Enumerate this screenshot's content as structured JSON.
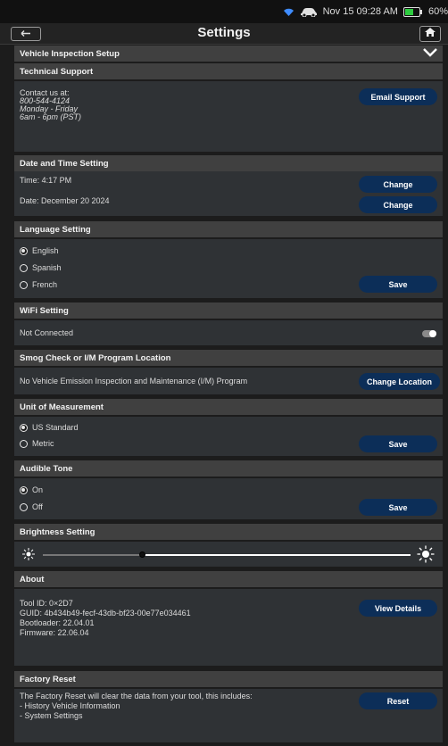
{
  "status": {
    "date_time": "Nov 15  09:28 AM",
    "battery": "60%",
    "battery_level": 0.6
  },
  "header": {
    "title": "Settings"
  },
  "vehicle_inspection": {
    "title": "Vehicle Inspection Setup"
  },
  "technical_support": {
    "title": "Technical Support",
    "contact_label": "Contact us at:",
    "phone": "800-544-4124",
    "days": "Monday - Friday",
    "hours": "6am - 6pm (PST)",
    "email_button": "Email Support"
  },
  "date_time": {
    "title": "Date and Time Setting",
    "time": "Time: 4:17 PM",
    "date": "Date: December 20 2024",
    "change_button": "Change"
  },
  "language": {
    "title": "Language Setting",
    "options": [
      "English",
      "Spanish",
      "French"
    ],
    "selected": "English",
    "save_button": "Save"
  },
  "wifi": {
    "title": "WiFi Setting",
    "status": "Not Connected"
  },
  "smog": {
    "title": "Smog Check or I/M Program Location",
    "program": "No Vehicle Emission Inspection and Maintenance (I/M) Program",
    "change_button": "Change Location"
  },
  "units": {
    "title": "Unit of Measurement",
    "options": [
      "US Standard",
      "Metric"
    ],
    "selected": "US Standard",
    "save_button": "Save"
  },
  "tone": {
    "title": "Audible Tone",
    "options": [
      "On",
      "Off"
    ],
    "selected": "On",
    "save_button": "Save"
  },
  "brightness": {
    "title": "Brightness Setting",
    "level": 0.27
  },
  "about": {
    "title": "About",
    "tool_id": "Tool ID: 0×2D7",
    "guid": "GUID: 4b434b49-fecf-43db-bf23-00e77e034461",
    "bootloader": "Bootloader: 22.04.01",
    "firmware": "Firmware: 22.06.04",
    "details_button": "View Details"
  },
  "factory_reset": {
    "title": "Factory Reset",
    "description": "The Factory Reset will clear the data from your tool, this includes:",
    "item1": "- History Vehicle Information",
    "item2": "- System Settings",
    "reset_button": "Reset"
  }
}
